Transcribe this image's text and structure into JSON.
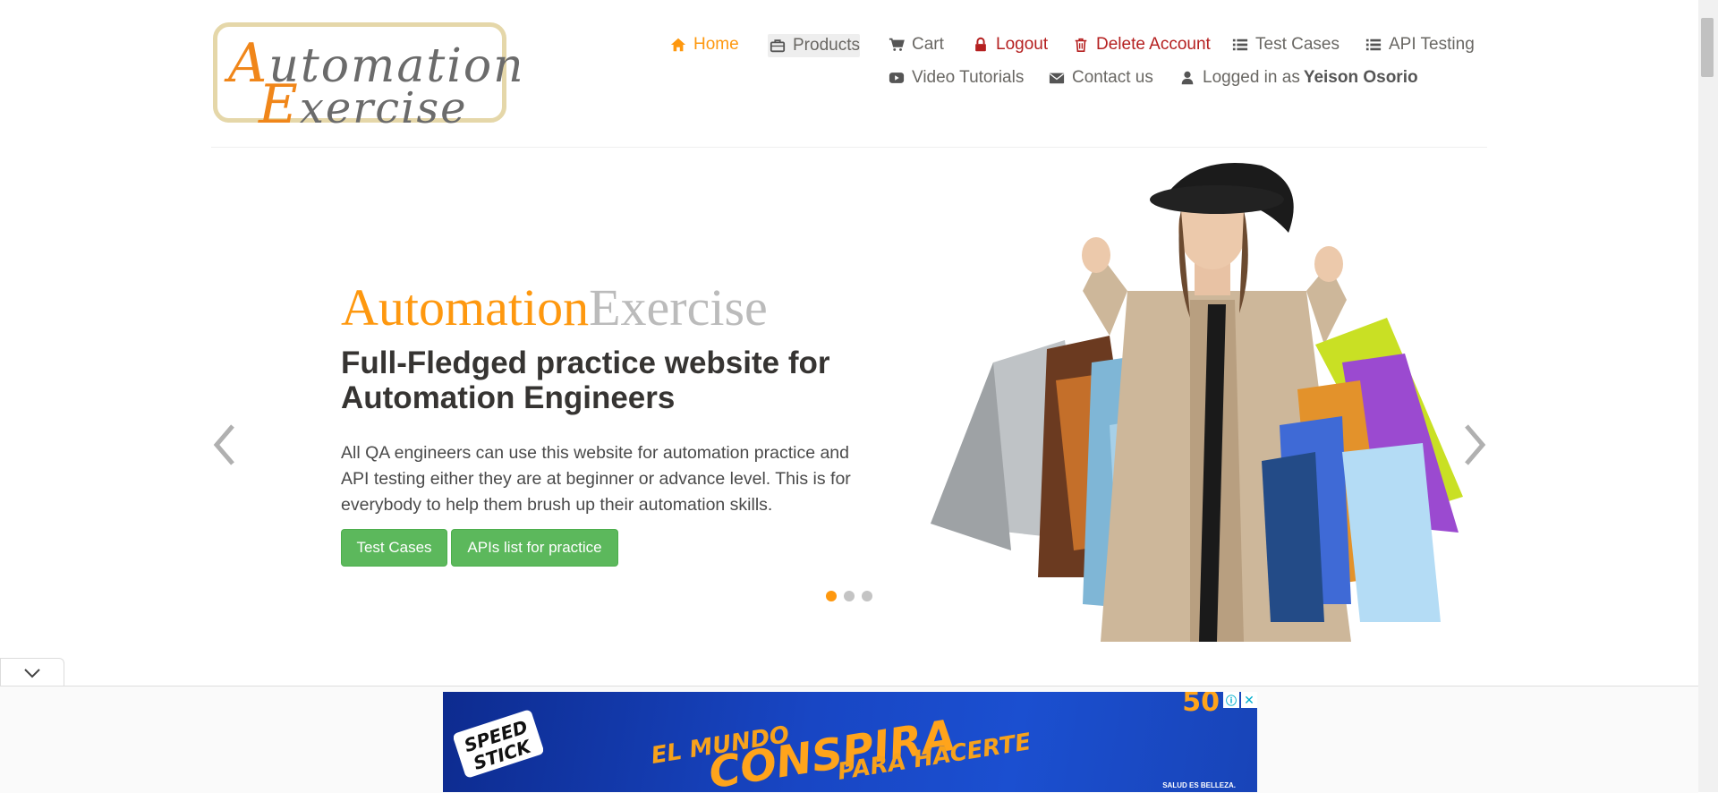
{
  "logo": {
    "line1_cap": "A",
    "line1_rest": "utomation",
    "line2_cap": "E",
    "line2_rest": "xercise"
  },
  "nav": {
    "home": "Home",
    "products": "Products",
    "cart": "Cart",
    "logout": "Logout",
    "delete_account": "Delete Account",
    "test_cases": "Test Cases",
    "api_testing": "API Testing",
    "video_tutorials": "Video Tutorials",
    "contact_us": "Contact us",
    "logged_in_prefix": "Logged in as",
    "logged_in_user": "Yeison Osorio"
  },
  "hero": {
    "brand_part1": "Automation",
    "brand_part2": "Exercise",
    "headline": "Full-Fledged practice website for Automation Engineers",
    "description": "All QA engineers can use this website for automation practice and API testing either they are at beginner or advance level. This is for everybody to help them brush up their automation skills.",
    "button_test_cases": "Test Cases",
    "button_apis": "APIs list for practice",
    "active_slide": 1,
    "slide_count": 3
  },
  "ad": {
    "brand": "SPEED STICK",
    "line1": "EL MUNDO",
    "line2": "CONSPIRA",
    "line3": "PARA HACERTE",
    "corner_text": "50",
    "footer_text": "SALUD ES BELLEZA."
  },
  "colors": {
    "accent": "#fe980f",
    "danger": "#b52020",
    "button_green": "#5cb85c",
    "text": "#696763"
  },
  "icons": {
    "home": "home-icon",
    "products": "briefcase-icon",
    "cart": "cart-icon",
    "logout": "lock-icon",
    "delete_account": "trash-icon",
    "test_cases": "list-icon",
    "api_testing": "list-icon",
    "video_tutorials": "youtube-play-icon",
    "contact_us": "envelope-icon",
    "logged_in": "user-icon"
  }
}
